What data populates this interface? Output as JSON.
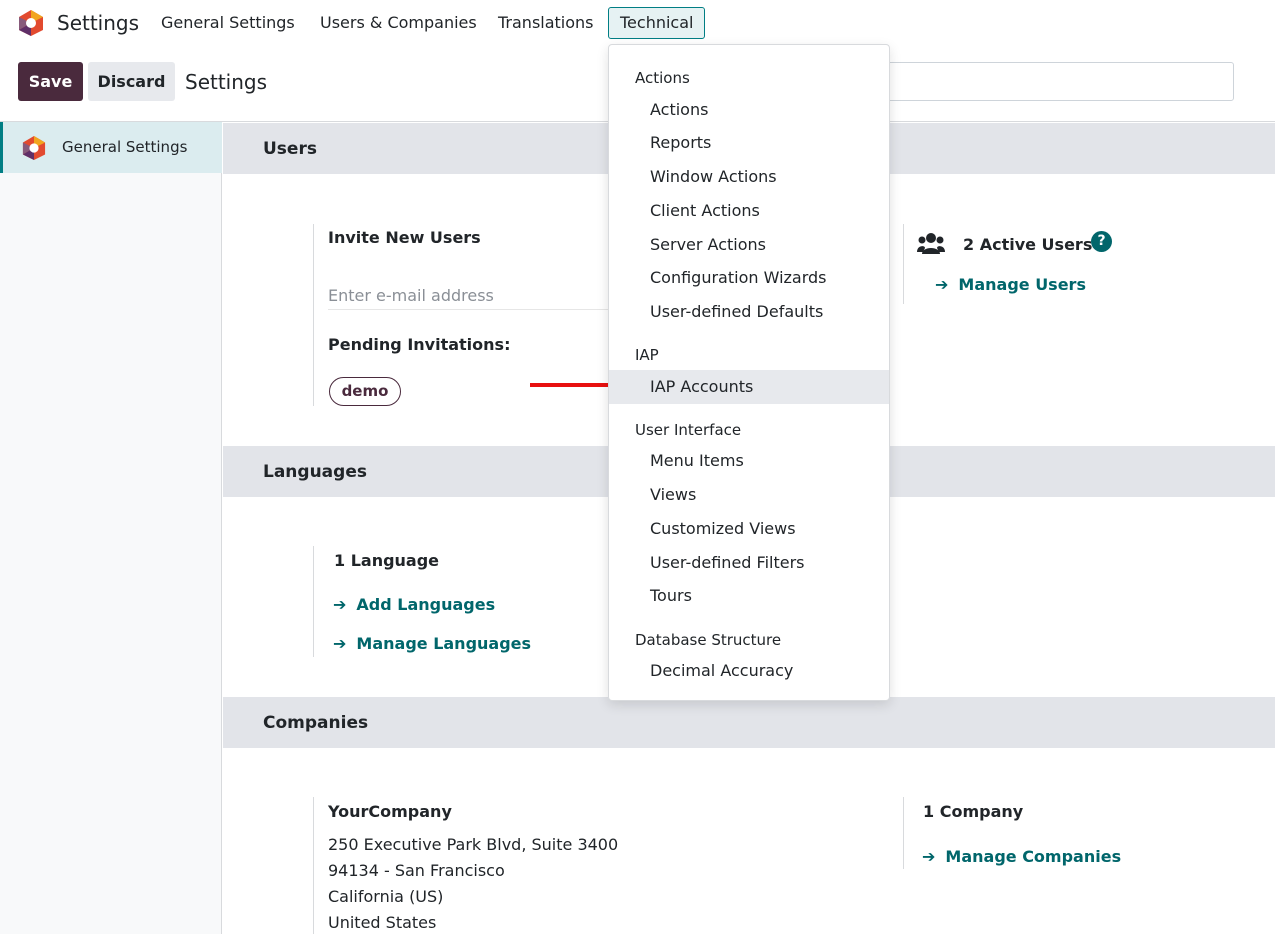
{
  "topbar": {
    "app_name": "Settings",
    "menu": [
      "General Settings",
      "Users & Companies",
      "Translations",
      "Technical"
    ]
  },
  "controls": {
    "save_label": "Save",
    "discard_label": "Discard",
    "breadcrumb": "Settings"
  },
  "sidebar": {
    "items": [
      {
        "label": "General Settings",
        "icon": "app-logo-icon"
      }
    ]
  },
  "users_section": {
    "title": "Users",
    "invite_title": "Invite New Users",
    "email_placeholder": "Enter e-mail address",
    "pending_label": "Pending Invitations:",
    "pending_badge": "demo",
    "active_users": "2 Active Users",
    "manage_users": "Manage Users",
    "help_icon": "?"
  },
  "languages_section": {
    "title": "Languages",
    "count": "1 Language",
    "add_link": "Add Languages",
    "manage_link": "Manage Languages"
  },
  "companies_section": {
    "title": "Companies",
    "company_name": "YourCompany",
    "address_lines": [
      "250 Executive Park Blvd, Suite 3400",
      "94134 - San Francisco",
      "California (US)",
      "United States"
    ],
    "count": "1 Company",
    "manage_link": "Manage Companies"
  },
  "dropdown": {
    "groups": [
      {
        "header": "Actions",
        "items": [
          "Actions",
          "Reports",
          "Window Actions",
          "Client Actions",
          "Server Actions",
          "Configuration Wizards",
          "User-defined Defaults"
        ]
      },
      {
        "header": "IAP",
        "items": [
          "IAP Accounts"
        ]
      },
      {
        "header": "User Interface",
        "items": [
          "Menu Items",
          "Views",
          "Customized Views",
          "User-defined Filters",
          "Tours"
        ]
      },
      {
        "header": "Database Structure",
        "items": [
          "Decimal Accuracy"
        ]
      }
    ],
    "highlighted": "IAP Accounts"
  },
  "colors": {
    "brand": "#4a2a3d",
    "accent": "#017e84",
    "link": "#01666b",
    "annotation_arrow": "#e8100f"
  }
}
